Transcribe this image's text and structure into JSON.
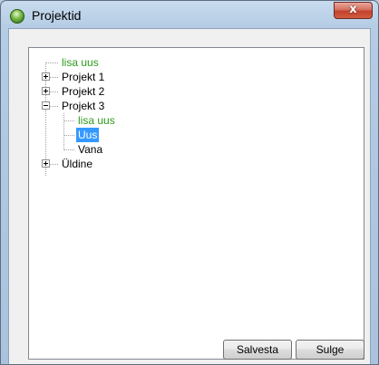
{
  "window": {
    "title": "Projektid",
    "close_glyph": "x"
  },
  "tree": {
    "root_action": "lisa uus",
    "items": [
      {
        "label": "Projekt 1",
        "expander": "plus"
      },
      {
        "label": "Projekt 2",
        "expander": "plus"
      },
      {
        "label": "Projekt 3",
        "expander": "minus",
        "children": [
          {
            "label": "lisa uus",
            "style": "action"
          },
          {
            "label": "Uus",
            "selected": true
          },
          {
            "label": "Vana"
          }
        ]
      },
      {
        "label": "Üldine",
        "expander": "plus"
      }
    ]
  },
  "buttons": {
    "save_label": "Salvesta",
    "close_label": "Sulge"
  },
  "colors": {
    "action_text": "#2b9a1b",
    "selection": "#3399ff"
  }
}
